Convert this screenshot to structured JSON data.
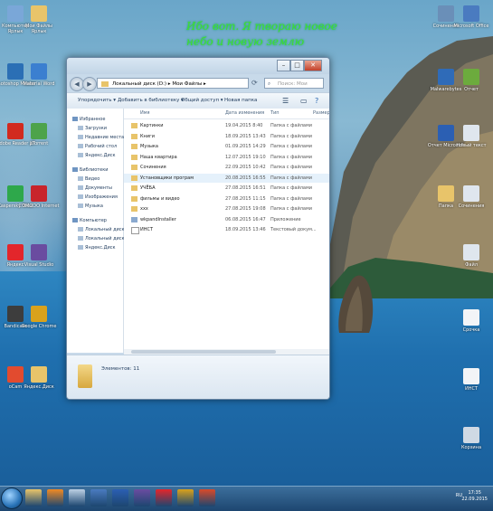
{
  "wallpaper_text": [
    "Ибо вот. Я твораю новое",
    "небо и новую землю"
  ],
  "desktop_left_icons": [
    {
      "label": "Компьютер Ярлык",
      "icon": "computer-icon",
      "color": "#7aa7d8"
    },
    {
      "label": "Мои Файлы Ярлык",
      "icon": "folder-shortcut-icon",
      "color": "#e8c46a"
    },
    {
      "label": "Photoshop Master",
      "icon": "photoshop-icon",
      "color": "#2b6fb5"
    },
    {
      "label": "Material Word",
      "icon": "word-doc-icon",
      "color": "#3b7fd0"
    },
    {
      "label": "Adobe Reader XI",
      "icon": "adobe-reader-icon",
      "color": "#d22a1f"
    },
    {
      "label": "µTorrent",
      "icon": "utorrent-icon",
      "color": "#4da34a"
    },
    {
      "label": "Kaspersky Total",
      "icon": "kaspersky-icon",
      "color": "#2ea84b"
    },
    {
      "label": "COMODO Internet",
      "icon": "comodo-icon",
      "color": "#c8242b"
    },
    {
      "label": "Яндекс",
      "icon": "yandex-icon",
      "color": "#e3262b"
    },
    {
      "label": "Visual Studio",
      "icon": "visual-studio-icon",
      "color": "#6a4ca0"
    },
    {
      "label": "Bandicam",
      "icon": "bandicam-icon",
      "color": "#3d3d3d"
    },
    {
      "label": "Google Chrome",
      "icon": "chrome-icon",
      "color": "#d9a21c"
    },
    {
      "label": "oCam",
      "icon": "ocam-icon",
      "color": "#e24b2f"
    },
    {
      "label": "Яндекс.Диск",
      "icon": "yandex-disk-icon",
      "color": "#e8c46a"
    }
  ],
  "desktop_right_icons": [
    {
      "label": "Сочинения",
      "icon": "settings-icon",
      "color": "#6a8fb8"
    },
    {
      "label": "Microsoft Office",
      "icon": "office-icon",
      "color": "#4a7bc0"
    },
    {
      "label": "Malwarebytes",
      "icon": "malwarebytes-icon",
      "color": "#2f6bb8"
    },
    {
      "label": "Отчет",
      "icon": "report-icon",
      "color": "#6cab3d"
    },
    {
      "label": "Отчет Microsoft",
      "icon": "word-icon",
      "color": "#2b5fb3"
    },
    {
      "label": "Новый текст",
      "icon": "text-doc-icon",
      "color": "#dfe6ee"
    },
    {
      "label": "Папка",
      "icon": "folder-icon",
      "color": "#e8c46a"
    },
    {
      "label": "Сочинения",
      "icon": "doc-icon",
      "color": "#dfe6ee"
    },
    {
      "label": "Файл",
      "icon": "file-icon",
      "color": "#dfe6ee"
    },
    {
      "label": "Срочка",
      "icon": "text-file-icon",
      "color": "#f2f4f7"
    },
    {
      "label": "ИНСТ",
      "icon": "text-file-icon",
      "color": "#f2f4f7"
    },
    {
      "label": "Корзина",
      "icon": "recycle-bin-icon",
      "color": "#cfd9e4"
    }
  ],
  "window": {
    "address_path": "Локальный диск (D:) ▸ Мои Файлы ▸",
    "search_placeholder": "Поиск: Мои Файлы",
    "toolbar": {
      "organize": "Упорядочить ▾",
      "add_to_library": "Добавить в библиотеку ▾",
      "share": "Общий доступ ▾",
      "new_folder": "Новая папка"
    },
    "columns": {
      "name": "Имя",
      "date": "Дата изменения",
      "type": "Тип",
      "size": "Размер"
    },
    "nav_items": [
      {
        "label": "Избранное",
        "icon": "star-icon",
        "group": true
      },
      {
        "label": "Загрузки",
        "icon": "downloads-icon",
        "group": false
      },
      {
        "label": "Недавние места",
        "icon": "recent-places-icon",
        "group": false
      },
      {
        "label": "Рабочий стол",
        "icon": "desktop-icon",
        "group": false
      },
      {
        "label": "Яндекс.Диск",
        "icon": "yandex-disk-icon",
        "group": false
      },
      {
        "label": "Библиотеки",
        "icon": "libraries-icon",
        "group": true
      },
      {
        "label": "Видео",
        "icon": "video-icon",
        "group": false
      },
      {
        "label": "Документы",
        "icon": "documents-icon",
        "group": false
      },
      {
        "label": "Изображения",
        "icon": "pictures-icon",
        "group": false
      },
      {
        "label": "Музыка",
        "icon": "music-icon",
        "group": false
      },
      {
        "label": "Компьютер",
        "icon": "computer-icon",
        "group": true
      },
      {
        "label": "Локальный диск",
        "icon": "drive-icon",
        "group": false
      },
      {
        "label": "Локальный диск",
        "icon": "drive-icon",
        "group": false
      },
      {
        "label": "Яндекс.Диск",
        "icon": "yandex-disk-icon",
        "group": false
      }
    ],
    "files": [
      {
        "name": "Картинки",
        "date": "19.04.2015 8:40",
        "type": "Папка с файлами",
        "icon": "folder-icon"
      },
      {
        "name": "Книги",
        "date": "18.09.2015 13:43",
        "type": "Папка с файлами",
        "icon": "folder-icon"
      },
      {
        "name": "Музыка",
        "date": "01.09.2015 14:29",
        "type": "Папка с файлами",
        "icon": "folder-icon"
      },
      {
        "name": "Наша квартира",
        "date": "12.07.2015 19:10",
        "type": "Папка с файлами",
        "icon": "folder-icon"
      },
      {
        "name": "Сочинения",
        "date": "22.09.2015 10:42",
        "type": "Папка с файлами",
        "icon": "folder-icon"
      },
      {
        "name": "Установщики програм",
        "date": "20.08.2015 16:55",
        "type": "Папка с файлами",
        "icon": "folder-icon"
      },
      {
        "name": "УЧЁБА",
        "date": "27.08.2015 16:51",
        "type": "Папка с файлами",
        "icon": "folder-icon"
      },
      {
        "name": "фильмы и видео",
        "date": "27.08.2015 11:15",
        "type": "Папка с файлами",
        "icon": "folder-icon"
      },
      {
        "name": "ххх",
        "date": "27.08.2015 19:08",
        "type": "Папка с файлами",
        "icon": "folder-icon"
      },
      {
        "name": "wkpandInstaller",
        "date": "06.08.2015 16:47",
        "type": "Приложение",
        "icon": "installer-icon"
      },
      {
        "name": "ИНСТ",
        "date": "18.09.2015 13:46",
        "type": "Текстовый докум...",
        "icon": "text-file-icon"
      }
    ],
    "hover_row_index": 5,
    "details_text": "Элементов: 11"
  },
  "taskbar": {
    "apps": [
      {
        "name": "explorer-icon",
        "color": "#e8c46a"
      },
      {
        "name": "media-player-icon",
        "color": "#f08a24"
      },
      {
        "name": "search-icon",
        "color": "#bcd0e4"
      },
      {
        "name": "pen-icon",
        "color": "#4a7bc0"
      },
      {
        "name": "word-icon",
        "color": "#2b5fb3"
      },
      {
        "name": "visual-studio-icon",
        "color": "#6a4ca0"
      },
      {
        "name": "yandex-icon",
        "color": "#e3262b"
      },
      {
        "name": "chrome-icon",
        "color": "#d9a21c"
      },
      {
        "name": "presentation-icon",
        "color": "#d84a2a"
      }
    ],
    "tray_text": "RU",
    "time": "17:35",
    "date": "22.09.2015"
  }
}
